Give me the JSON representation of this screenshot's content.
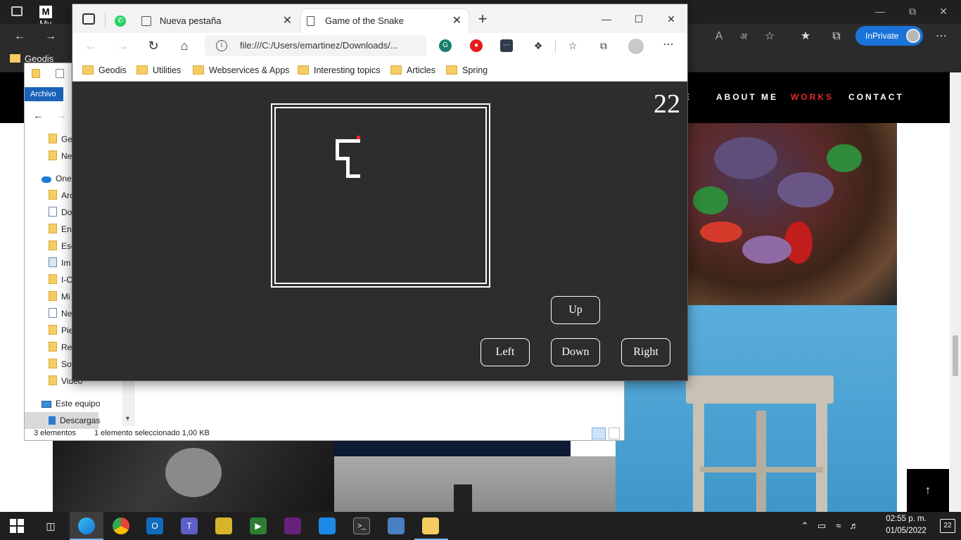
{
  "background_browser": {
    "tab_partial": "My",
    "favorites": [
      "Geodis"
    ],
    "inprivate_label": "InPrivate"
  },
  "website": {
    "nav": [
      {
        "label": "E",
        "active": false
      },
      {
        "label": "ABOUT ME",
        "active": false
      },
      {
        "label": "WORKS",
        "active": true
      },
      {
        "label": "CONTACT",
        "active": false
      }
    ],
    "scroll_top_icon": "↑",
    "accent_color": "#e22a2a"
  },
  "explorer": {
    "ribbon_tab": "Archivo",
    "tree_items": [
      {
        "label": "Ge",
        "icon": "folder"
      },
      {
        "label": "Ne",
        "icon": "folder"
      },
      {
        "label": "One",
        "icon": "cloud"
      },
      {
        "label": "Arc",
        "icon": "folder"
      },
      {
        "label": "Do",
        "icon": "doc"
      },
      {
        "label": "En",
        "icon": "folder"
      },
      {
        "label": "Esc",
        "icon": "folder"
      },
      {
        "label": "Im",
        "icon": "img"
      },
      {
        "label": "I-C",
        "icon": "folder"
      },
      {
        "label": "Mi",
        "icon": "folder"
      },
      {
        "label": "Ne",
        "icon": "doc"
      },
      {
        "label": "Pie",
        "icon": "folder"
      },
      {
        "label": "Rec",
        "icon": "folder"
      },
      {
        "label": "Sof",
        "icon": "folder"
      },
      {
        "label": "Video",
        "icon": "folder"
      },
      {
        "label": "Este equipo",
        "icon": "pc"
      },
      {
        "label": "Descargas",
        "icon": "down"
      }
    ],
    "status_count": "3 elementos",
    "status_selection": "1 elemento seleccionado  1,00 KB"
  },
  "front_browser": {
    "tabs": [
      {
        "label": "Nueva pestaña",
        "active": false
      },
      {
        "label": "Game of the Snake",
        "active": true
      }
    ],
    "address": "file:///C:/Users/emartinez/Downloads/...",
    "favorites": [
      "Geodis",
      "Utilities",
      "Webservices & Apps",
      "Interesting topics",
      "Articles",
      "Spring"
    ]
  },
  "game": {
    "score": "22",
    "controls": {
      "up": "Up",
      "left": "Left",
      "down": "Down",
      "right": "Right"
    },
    "board_bg": "#2d2d2d",
    "snake_color": "#ffffff",
    "food_color": "#ff2020"
  },
  "taskbar": {
    "time": "02:55 p. m.",
    "date": "01/05/2022",
    "notifications": "22"
  }
}
